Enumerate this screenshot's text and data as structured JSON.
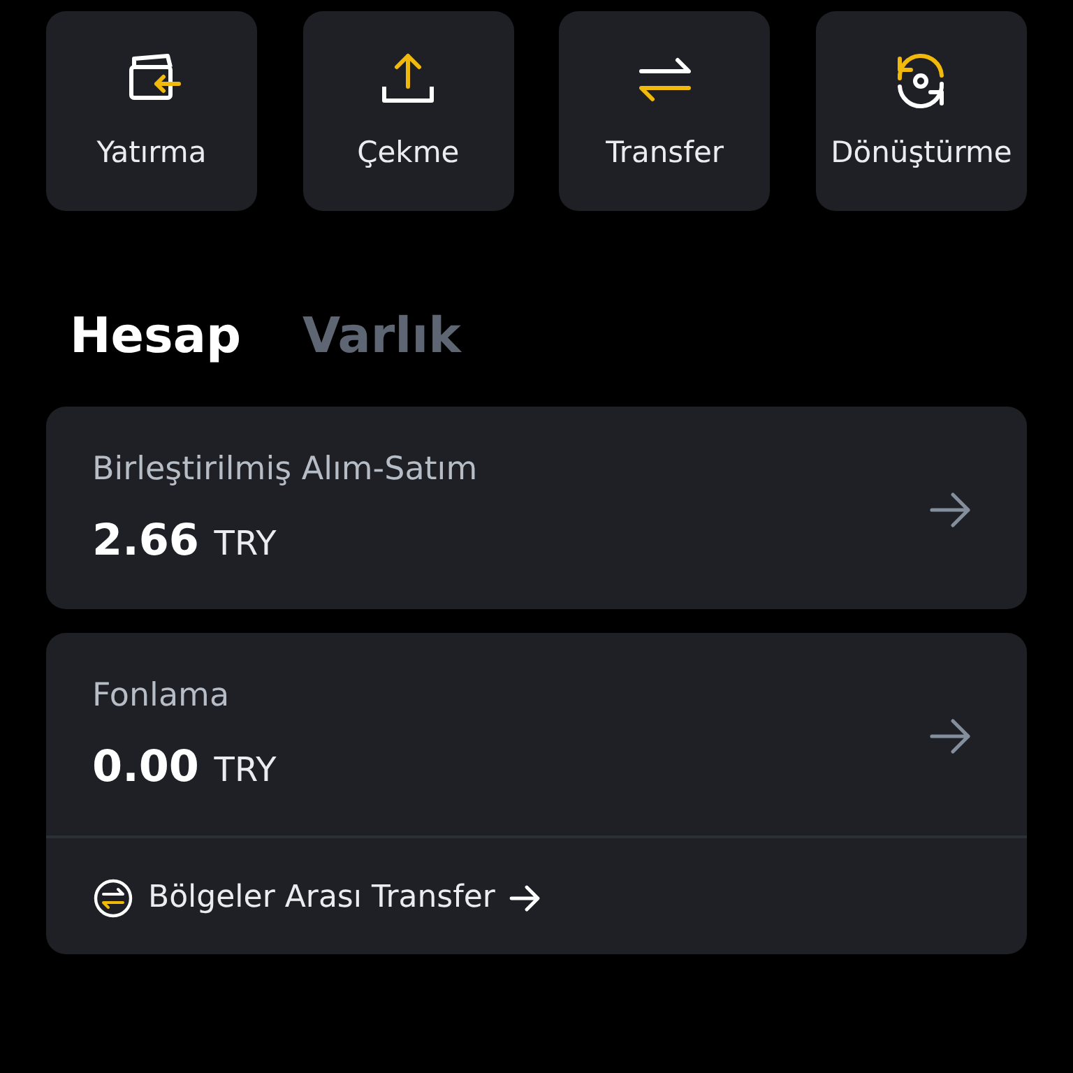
{
  "actions": [
    {
      "label": "Yatırma"
    },
    {
      "label": "Çekme"
    },
    {
      "label": "Transfer"
    },
    {
      "label": "Dönüştürme"
    }
  ],
  "tabs": [
    {
      "label": "Hesap",
      "selected": true
    },
    {
      "label": "Varlık",
      "selected": false
    }
  ],
  "accounts": [
    {
      "name": "Birleştirilmiş Alım-Satım",
      "amount": "2.66",
      "currency": "TRY"
    },
    {
      "name": "Fonlama",
      "amount": "0.00",
      "currency": "TRY",
      "link": "Bölgeler Arası Transfer"
    }
  ]
}
